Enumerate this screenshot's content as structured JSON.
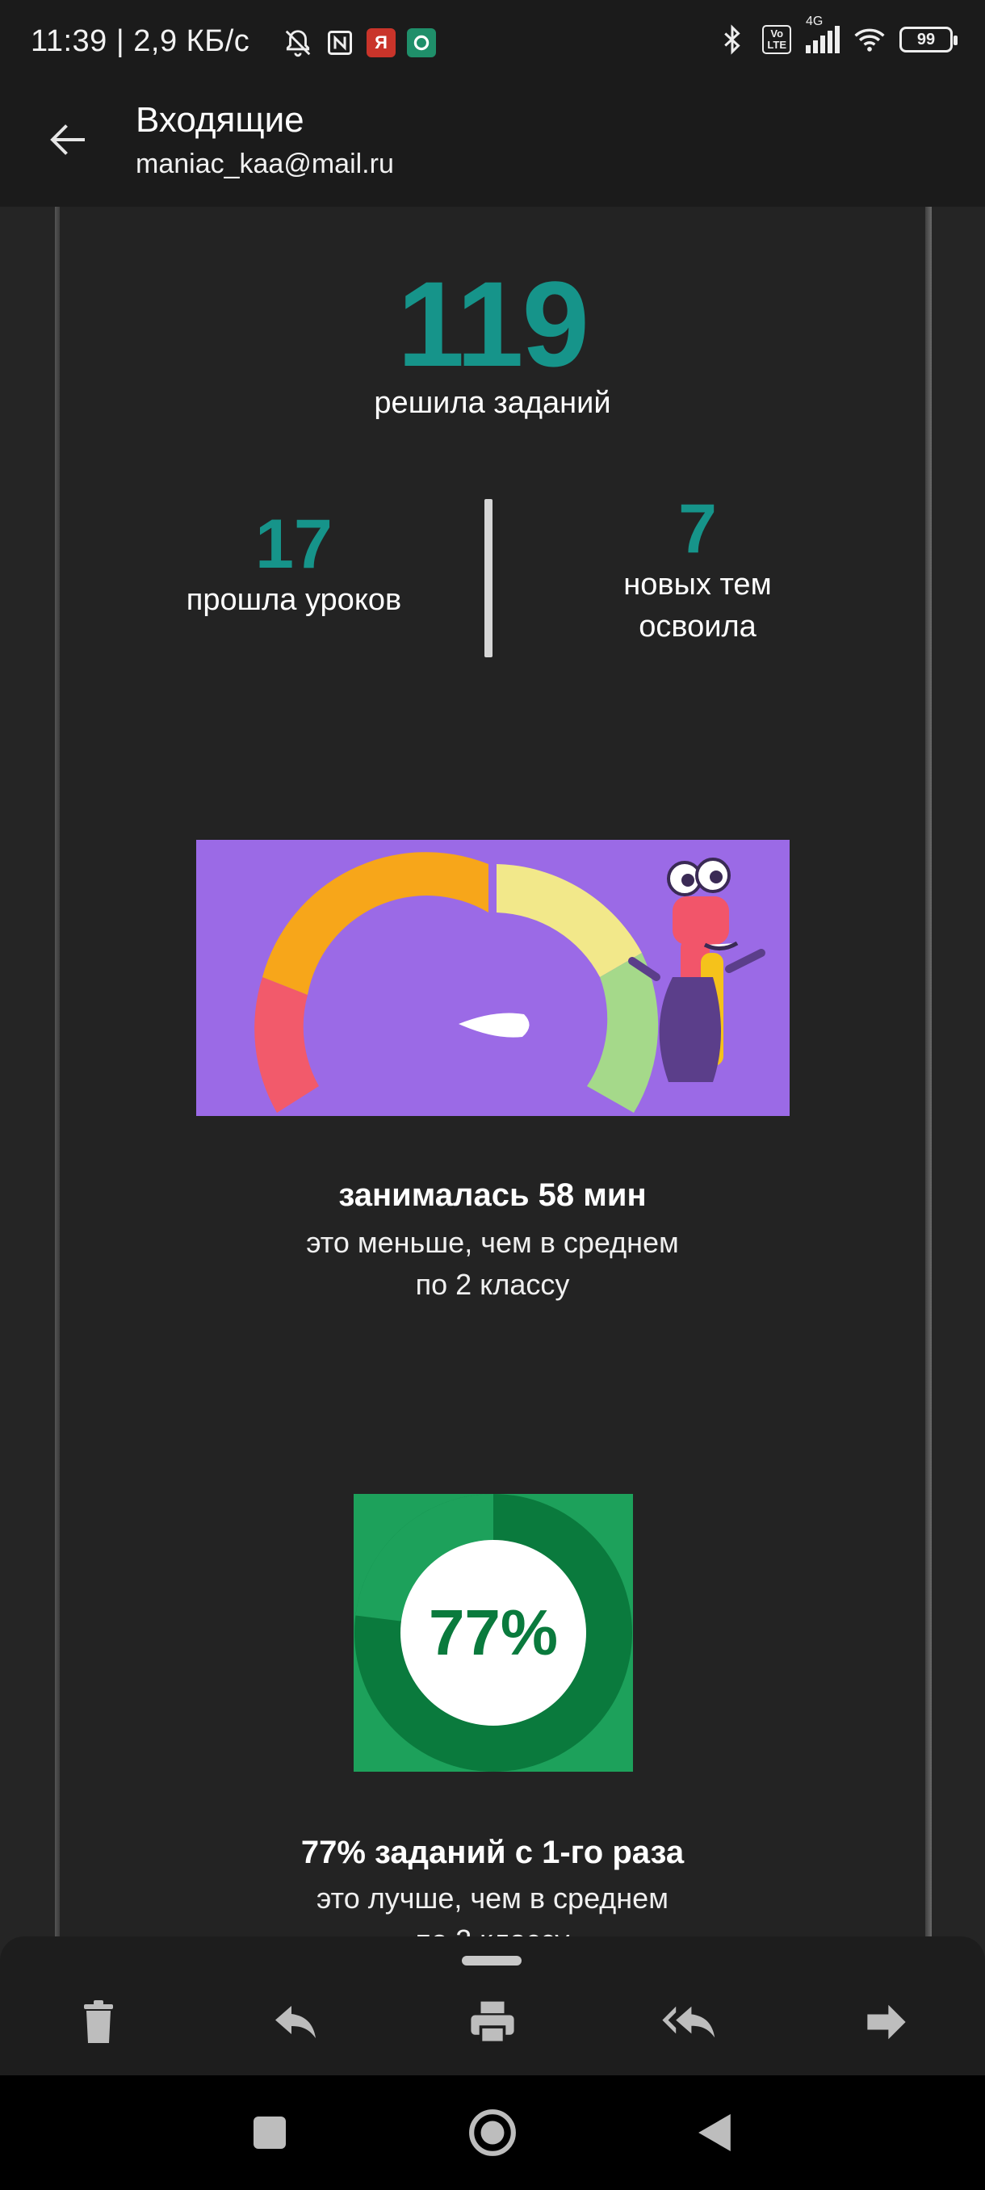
{
  "status_bar": {
    "time": "11:39",
    "network_speed": "2,9 КБ/с",
    "separator": "|",
    "volte_label_1": "Vo",
    "volte_label_2": "LTE",
    "network_type": "4G",
    "battery_level": "99",
    "icons": [
      "bell-off-icon",
      "nfc-icon",
      "yandex-app-icon",
      "green-app-icon",
      "bluetooth-icon",
      "volte-icon",
      "signal-icon",
      "wifi-icon",
      "battery-icon"
    ]
  },
  "app_bar": {
    "title": "Входящие",
    "account": "maniac_kaa@mail.ru"
  },
  "email": {
    "tasks_count": "119",
    "tasks_caption": "решила заданий",
    "lessons_count": "17",
    "lessons_caption": "прошла уроков",
    "topics_count": "7",
    "topics_caption_1": "новых тем",
    "topics_caption_2": "освоила",
    "time_title": "занималась 58 мин",
    "time_line_1": "это меньше, чем в среднем",
    "time_line_2": "по 2 классу",
    "percent_badge": "77%",
    "percent_value": 0.77,
    "percent_title": "77% заданий с 1-го раза",
    "percent_line_1": "это лучше, чем в среднем",
    "percent_line_2": "по 2 классу"
  },
  "actions": {
    "icons": [
      "delete-icon",
      "reply-icon",
      "print-icon",
      "reply-all-icon",
      "forward-icon"
    ]
  },
  "colors": {
    "accent_teal": "#16948a",
    "gauge_background": "#9b6ae6",
    "percent_green": "#1da15b",
    "percent_dark_green": "#0a7a3d"
  }
}
